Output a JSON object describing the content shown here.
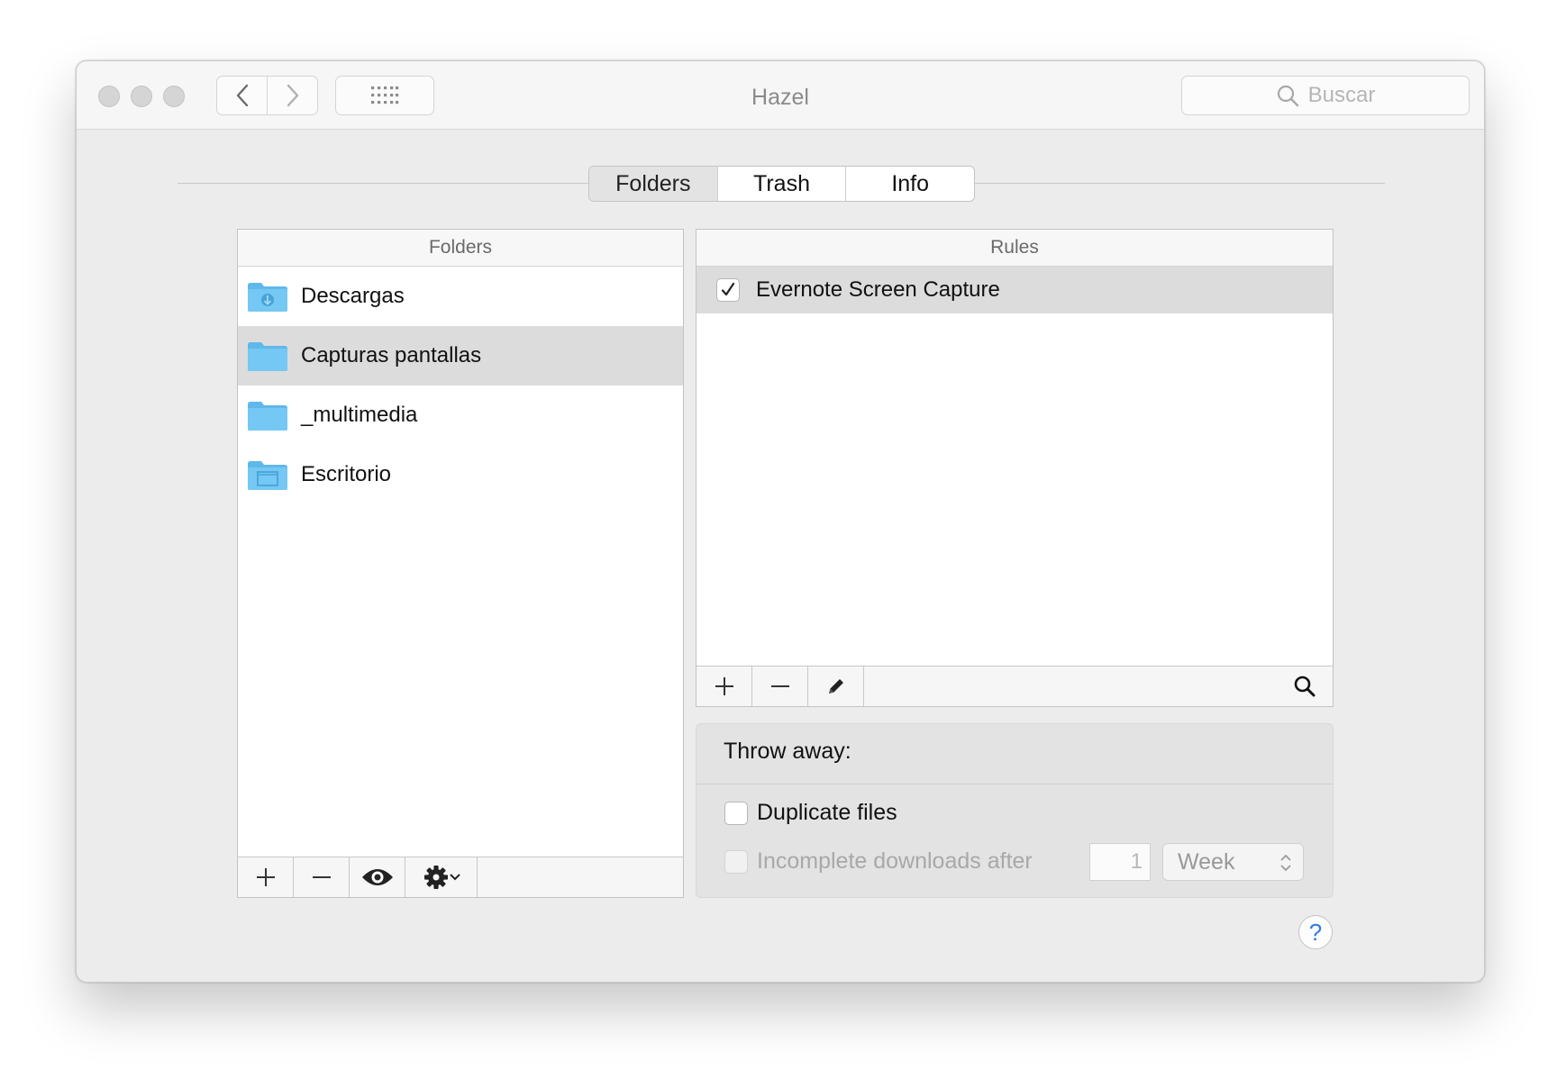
{
  "window": {
    "title": "Hazel"
  },
  "search": {
    "placeholder": "Buscar"
  },
  "tabs": [
    {
      "label": "Folders",
      "active": true
    },
    {
      "label": "Trash",
      "active": false
    },
    {
      "label": "Info",
      "active": false
    }
  ],
  "folders_panel": {
    "header": "Folders",
    "items": [
      {
        "label": "Descargas",
        "icon": "downloads-folder-icon",
        "selected": false
      },
      {
        "label": "Capturas pantallas",
        "icon": "folder-icon",
        "selected": true
      },
      {
        "label": "_multimedia",
        "icon": "folder-icon",
        "selected": false
      },
      {
        "label": "Escritorio",
        "icon": "desktop-folder-icon",
        "selected": false
      }
    ]
  },
  "rules_panel": {
    "header": "Rules",
    "items": [
      {
        "label": "Evernote Screen Capture",
        "checked": true,
        "selected": true
      }
    ]
  },
  "throw_away": {
    "title": "Throw away:",
    "duplicate_label": "Duplicate files",
    "duplicate_checked": false,
    "incomplete_label": "Incomplete downloads after",
    "incomplete_checked": false,
    "incomplete_enabled": false,
    "count": "1",
    "unit": "Week"
  },
  "colors": {
    "folder_blue": "#6cc3f0",
    "selection": "#dcdcdc",
    "help_blue": "#2f7ae5"
  }
}
